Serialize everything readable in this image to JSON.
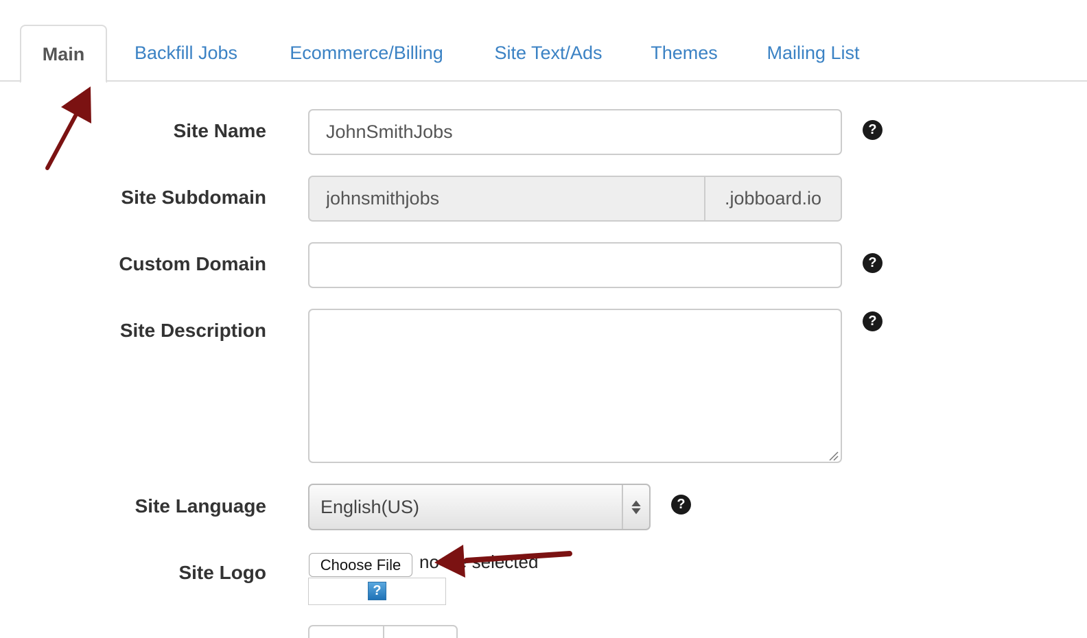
{
  "tabs": [
    {
      "label": "Main",
      "active": true
    },
    {
      "label": "Backfill Jobs",
      "active": false
    },
    {
      "label": "Ecommerce/Billing",
      "active": false
    },
    {
      "label": "Site Text/Ads",
      "active": false
    },
    {
      "label": "Themes",
      "active": false
    },
    {
      "label": "Mailing List",
      "active": false
    }
  ],
  "form": {
    "site_name": {
      "label": "Site Name",
      "value": "JohnSmithJobs"
    },
    "site_subdomain": {
      "label": "Site Subdomain",
      "value": "johnsmithjobs",
      "suffix": ".jobboard.io"
    },
    "custom_domain": {
      "label": "Custom Domain",
      "value": ""
    },
    "site_description": {
      "label": "Site Description",
      "value": ""
    },
    "site_language": {
      "label": "Site Language",
      "value": "English(US)"
    },
    "site_logo": {
      "label": "Site Logo",
      "button_label": "Choose File",
      "status": "no file selected",
      "broken_image_glyph": "?"
    }
  },
  "help_glyph": "?",
  "colors": {
    "tab_link": "#3b82c4",
    "annotation_arrow": "#7b1212",
    "help_icon": "#1a1a1a"
  },
  "icons": [
    "help-icon",
    "select-arrows-icon",
    "resize-grip-icon",
    "broken-image-icon",
    "annotation-arrow"
  ]
}
